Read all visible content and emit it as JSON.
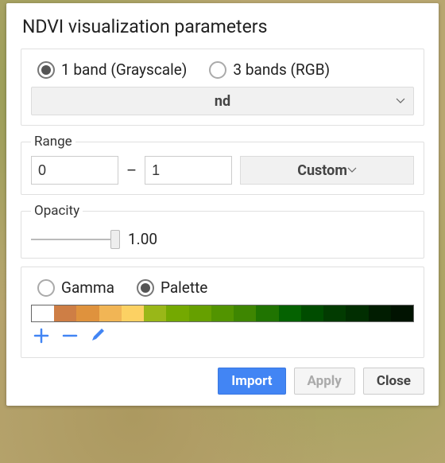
{
  "title": "NDVI visualization parameters",
  "bandMode": {
    "grayscale_label": "1 band (Grayscale)",
    "rgb_label": "3 bands (RGB)",
    "selected": "grayscale"
  },
  "bandSelect": {
    "value": "nd"
  },
  "range": {
    "legend": "Range",
    "min": "0",
    "max": "1",
    "preset": "Custom"
  },
  "opacity": {
    "legend": "Opacity",
    "value": "1.00",
    "position_pct": 96
  },
  "colorMode": {
    "gamma_label": "Gamma",
    "palette_label": "Palette",
    "selected": "palette"
  },
  "palette": {
    "colors": [
      "#FFFFFF",
      "#CE7E45",
      "#DF923D",
      "#F1B555",
      "#FCD163",
      "#99B718",
      "#74A901",
      "#66A000",
      "#529400",
      "#3E8601",
      "#207401",
      "#056201",
      "#004C00",
      "#023B01",
      "#012E01",
      "#011D01",
      "#011301"
    ]
  },
  "buttons": {
    "import": "Import",
    "apply": "Apply",
    "close": "Close"
  }
}
